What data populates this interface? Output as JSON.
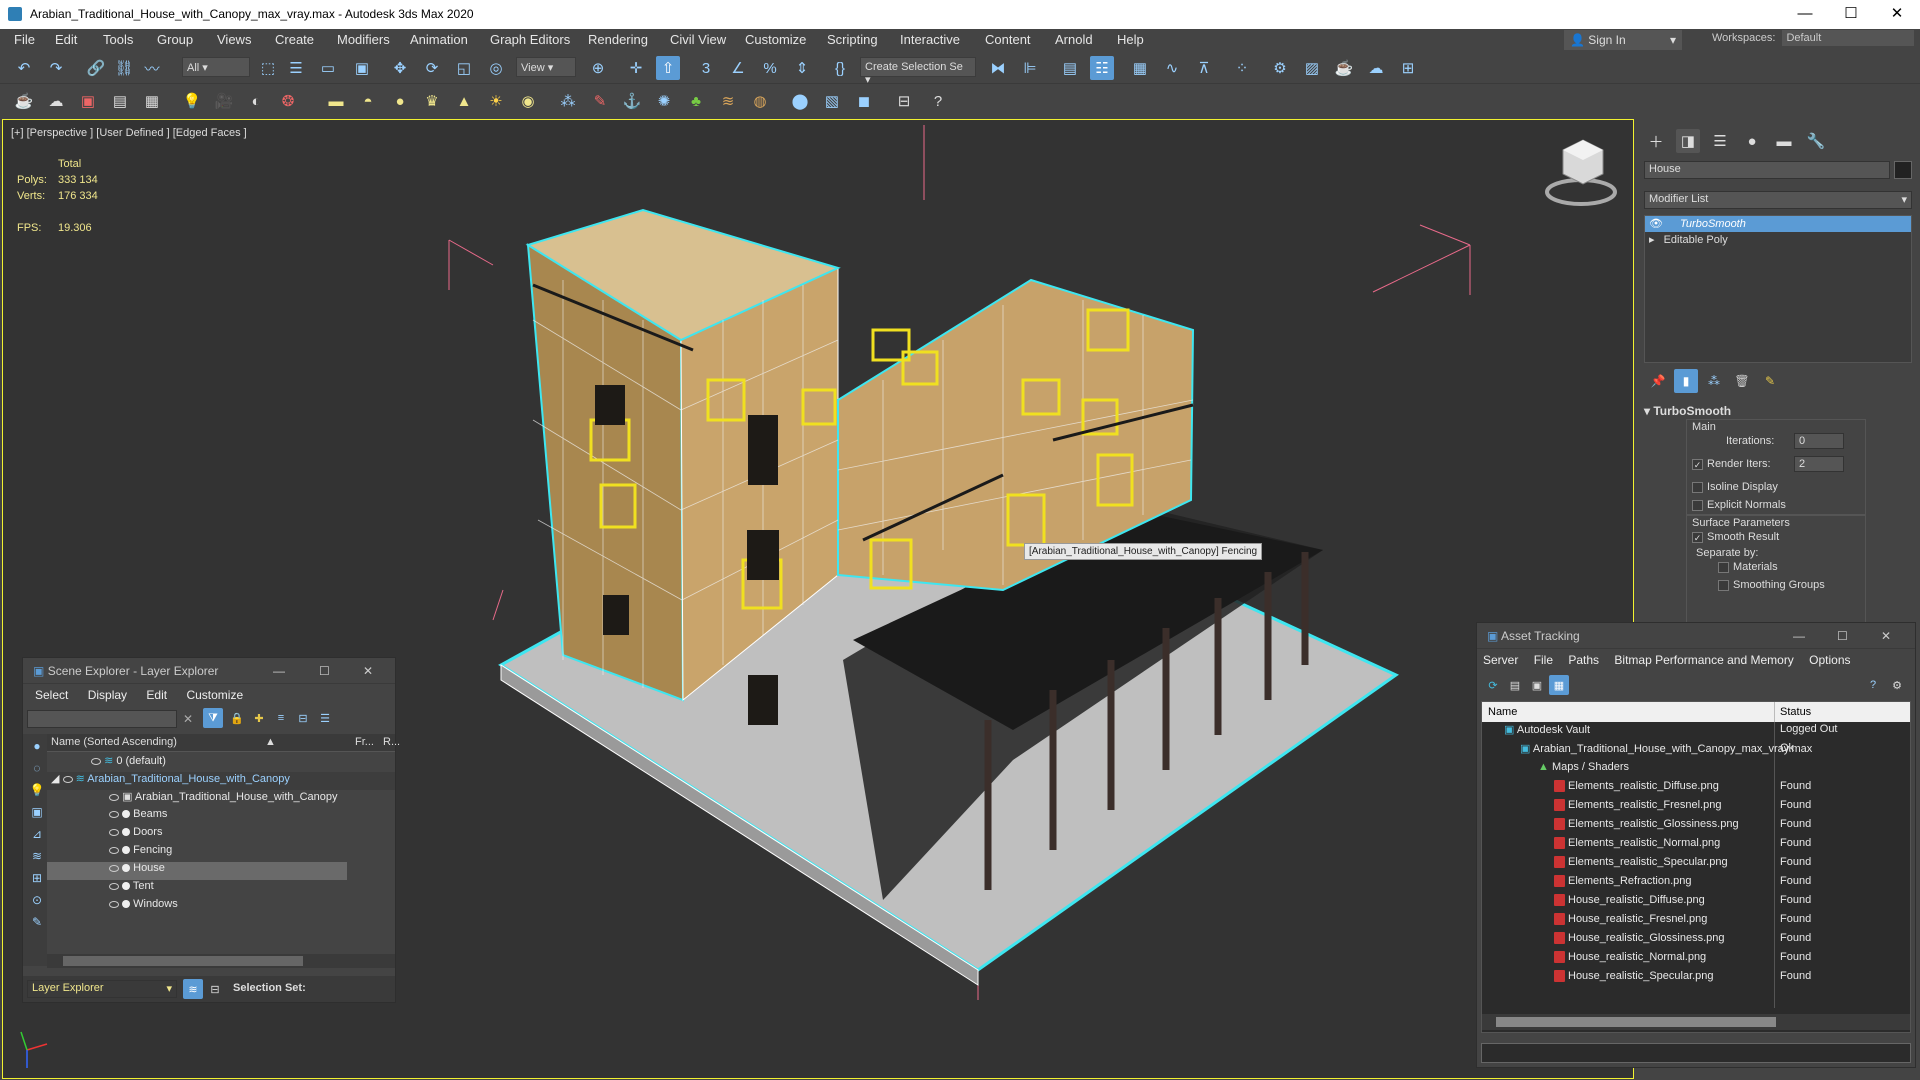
{
  "window": {
    "title": "Arabian_Traditional_House_with_Canopy_max_vray.max - Autodesk 3ds Max 2020",
    "min": "—",
    "max": "☐",
    "close": "✕"
  },
  "menu": [
    "File",
    "Edit",
    "Tools",
    "Group",
    "Views",
    "Create",
    "Modifiers",
    "Animation",
    "Graph Editors",
    "Rendering",
    "Civil View",
    "Customize",
    "Scripting",
    "Interactive",
    "Content",
    "Arnold",
    "Help"
  ],
  "toolbar": {
    "filter_dropdown": "All",
    "view_dropdown": "View",
    "selection_set": "Create Selection Se"
  },
  "account": {
    "sign_in": "Sign In",
    "workspaces_label": "Workspaces:",
    "workspace_value": "Default"
  },
  "viewport": {
    "label": "[+] [Perspective ] [User Defined ] [Edged Faces ]",
    "stats": {
      "total_label": "Total",
      "polys_label": "Polys:",
      "polys_value": "333 134",
      "verts_label": "Verts:",
      "verts_value": "176 334",
      "fps_label": "FPS:",
      "fps_value": "19.306"
    },
    "tooltip": "[Arabian_Traditional_House_with_Canopy] Fencing"
  },
  "command_panel": {
    "object_name": "House",
    "modifier_list": "Modifier List",
    "stack": [
      "TurboSmooth",
      "Editable Poly"
    ],
    "rollout_title": "TurboSmooth",
    "main_label": "Main",
    "iterations_label": "Iterations:",
    "iterations_value": "0",
    "render_iters_label": "Render Iters:",
    "render_iters_value": "2",
    "isoline": "Isoline Display",
    "explicit_normals": "Explicit Normals",
    "surface_params": "Surface Parameters",
    "smooth_result": "Smooth Result",
    "separate_by": "Separate by:",
    "materials": "Materials",
    "smoothing_groups": "Smoothing Groups"
  },
  "scene_explorer": {
    "title": "Scene Explorer - Layer Explorer",
    "menu": [
      "Select",
      "Display",
      "Edit",
      "Customize"
    ],
    "col_name": "Name (Sorted Ascending)",
    "col_fr": "Fr...",
    "col_r": "R...",
    "rows": [
      "0 (default)",
      "Arabian_Traditional_House_with_Canopy",
      "Arabian_Traditional_House_with_Canopy",
      "Beams",
      "Doors",
      "Fencing",
      "House",
      "Tent",
      "Windows"
    ],
    "footer_dropdown": "Layer Explorer",
    "selection_set": "Selection Set:"
  },
  "asset_tracking": {
    "title": "Asset Tracking",
    "menu": [
      "Server",
      "File",
      "Paths",
      "Bitmap Performance and Memory",
      "Options"
    ],
    "col_name": "Name",
    "col_status": "Status",
    "rows": [
      {
        "name": "Autodesk Vault",
        "status": "Logged Out"
      },
      {
        "name": "Arabian_Traditional_House_with_Canopy_max_vray.max",
        "status": "Ok"
      },
      {
        "name": "Maps / Shaders",
        "status": ""
      },
      {
        "name": "Elements_realistic_Diffuse.png",
        "status": "Found"
      },
      {
        "name": "Elements_realistic_Fresnel.png",
        "status": "Found"
      },
      {
        "name": "Elements_realistic_Glossiness.png",
        "status": "Found"
      },
      {
        "name": "Elements_realistic_Normal.png",
        "status": "Found"
      },
      {
        "name": "Elements_realistic_Specular.png",
        "status": "Found"
      },
      {
        "name": "Elements_Refraction.png",
        "status": "Found"
      },
      {
        "name": "House_realistic_Diffuse.png",
        "status": "Found"
      },
      {
        "name": "House_realistic_Fresnel.png",
        "status": "Found"
      },
      {
        "name": "House_realistic_Glossiness.png",
        "status": "Found"
      },
      {
        "name": "House_realistic_Normal.png",
        "status": "Found"
      },
      {
        "name": "House_realistic_Specular.png",
        "status": "Found"
      }
    ]
  },
  "colors": {
    "accent": "#5b9bd5",
    "selection_cyan": "#3ee6f0",
    "wire_yellow": "#f0e020"
  }
}
